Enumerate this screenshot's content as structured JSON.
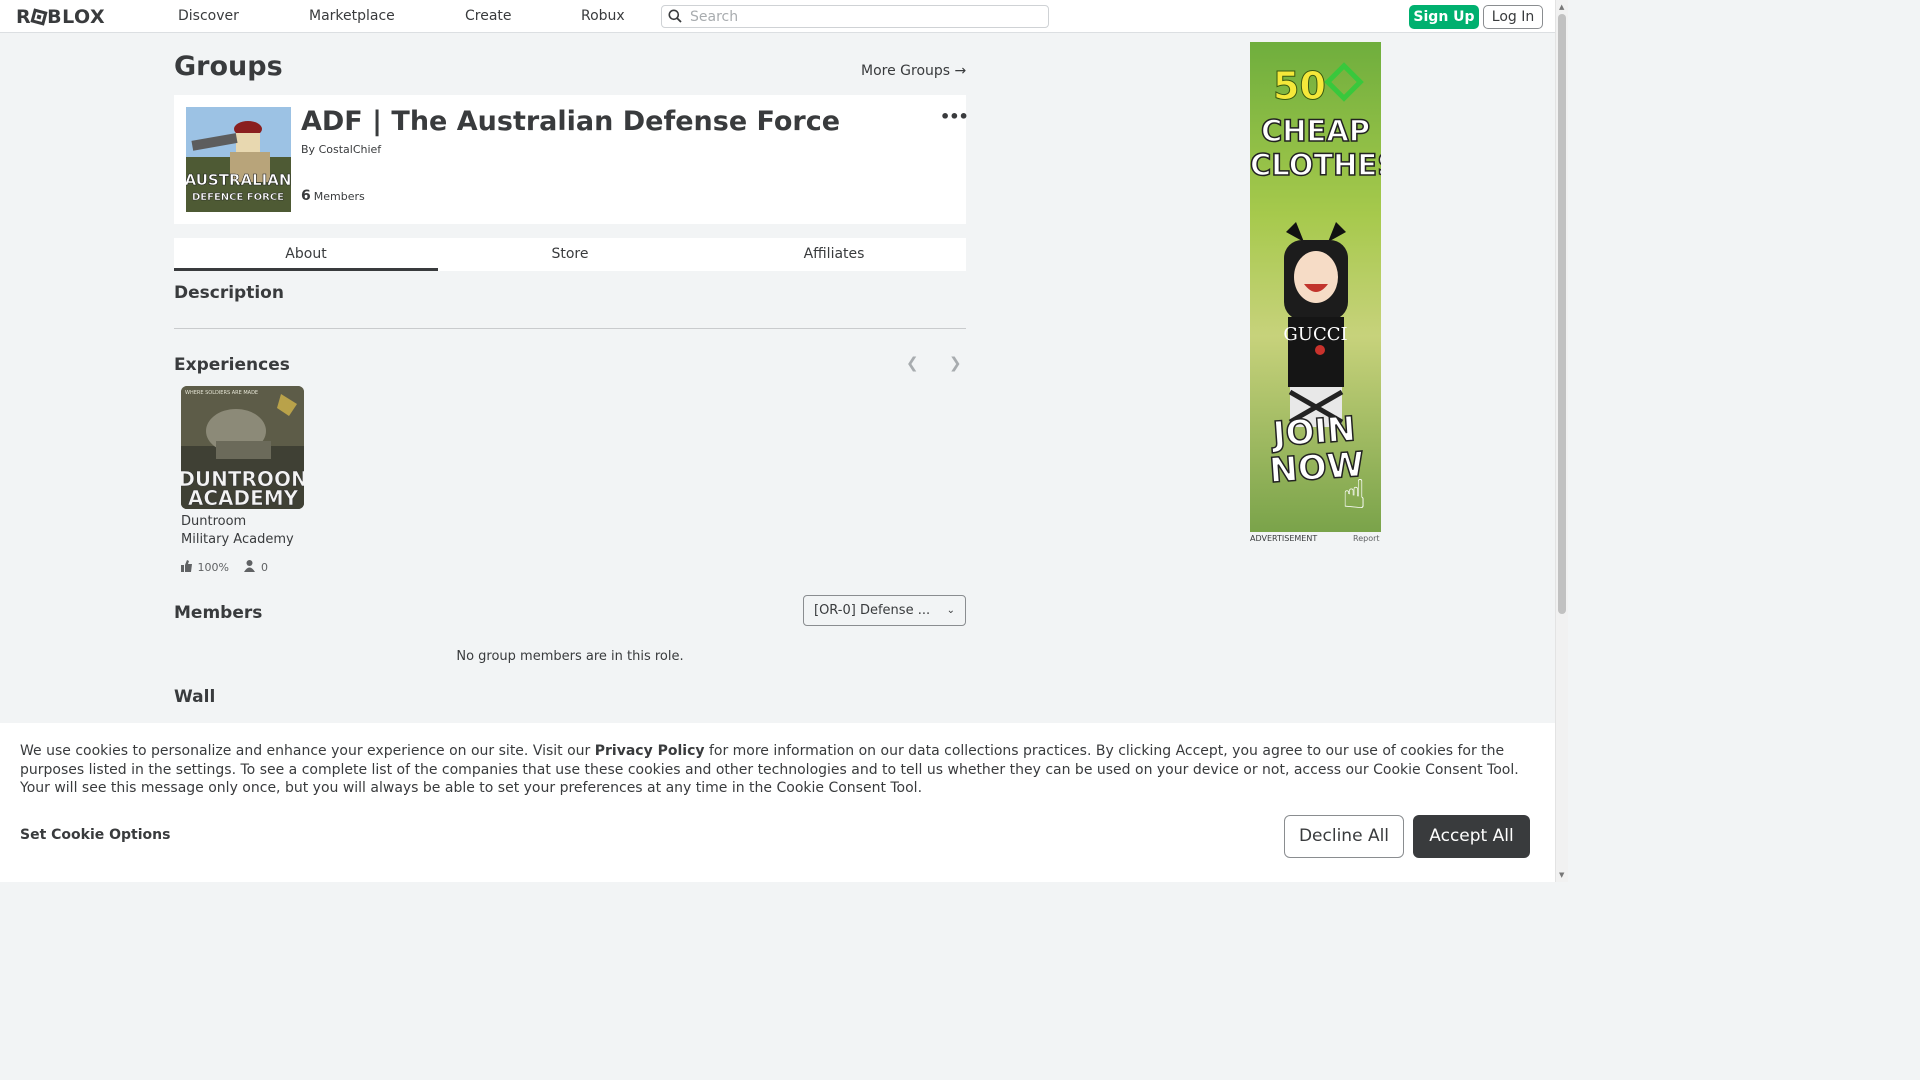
{
  "nav": {
    "logo": "ROBLOX",
    "links": [
      "Discover",
      "Marketplace",
      "Create",
      "Robux"
    ],
    "search_placeholder": "Search",
    "signup": "Sign Up",
    "login": "Log In"
  },
  "page": {
    "title": "Groups",
    "more_groups": "More Groups →"
  },
  "group": {
    "name": "ADF | The Australian Defense Force",
    "by_label": "By",
    "owner": "CostalChief",
    "member_count": "6",
    "member_label": "Members",
    "menu_dots": "•••",
    "thumb_text_line1": "AUSTRALIAN",
    "thumb_text_line2": "DEFENCE FORCE"
  },
  "tabs": [
    "About",
    "Store",
    "Affiliates"
  ],
  "about": {
    "description_heading": "Description",
    "experiences_heading": "Experiences",
    "experience": {
      "name_line1": "Duntroom",
      "name_line2": "Military Academy",
      "like_pct": "100%",
      "players": "0",
      "thumb_top_text": "WHERE SOLDIERS ARE MADE",
      "thumb_title_line1": "DUNTROON",
      "thumb_title_line2": "ACADEMY"
    },
    "members_heading": "Members",
    "role_select": "[OR-0] Defense ...",
    "no_members": "No group members are in this role.",
    "wall_heading": "Wall"
  },
  "ad": {
    "line_50": "50",
    "line_cheap": "CHEAP",
    "line_clothes": "CLOTHES",
    "line_gucci": "GUCCI",
    "line_join": "JOIN",
    "line_now": "NOW",
    "label": "ADVERTISEMENT",
    "report": "Report"
  },
  "cookie": {
    "text_before": "We use cookies to personalize and enhance your experience on our site. Visit our ",
    "privacy_link": "Privacy Policy",
    "text_after": " for more information on our data collections practices. By clicking Accept, you agree to our use of cookies for the purposes listed in the settings. To see a complete list of the companies that use these cookies and other technologies and to tell us whether they can be used on your device or not, access our Cookie Consent Tool. Your will see this message only once, but you will always be able to set your preferences at any time in the Cookie Consent Tool.",
    "set_options": "Set Cookie Options",
    "decline": "Decline All",
    "accept": "Accept All"
  },
  "colors": {
    "signup_green": "#00b06f",
    "text_dark": "#393b3d",
    "page_bg": "#f2f4f5"
  }
}
